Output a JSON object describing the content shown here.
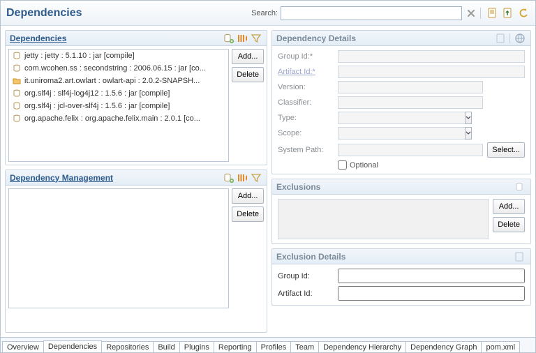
{
  "title": "Dependencies",
  "search": {
    "label": "Search:",
    "value": ""
  },
  "left": {
    "deps": {
      "title": "Dependencies",
      "add": "Add...",
      "delete": "Delete",
      "items": [
        "jetty : jetty : 5.1.10 : jar [compile]",
        "com.wcohen.ss : secondstring : 2006.06.15 : jar [co...",
        "it.uniroma2.art.owlart : owlart-api : 2.0.2-SNAPSH...",
        "org.slf4j : slf4j-log4j12 : 1.5.6 : jar [compile]",
        "org.slf4j : jcl-over-slf4j : 1.5.6 : jar [compile]",
        "org.apache.felix : org.apache.felix.main : 2.0.1 [co..."
      ]
    },
    "mgmt": {
      "title": "Dependency Management",
      "add": "Add...",
      "delete": "Delete"
    }
  },
  "details": {
    "title": "Dependency Details",
    "labels": {
      "group": "Group Id:",
      "artifact": "Artifact Id:",
      "version": "Version:",
      "classifier": "Classifier:",
      "type": "Type:",
      "scope": "Scope:",
      "syspath": "System Path:",
      "optional": "Optional",
      "select": "Select..."
    }
  },
  "exclusions": {
    "title": "Exclusions",
    "add": "Add...",
    "delete": "Delete"
  },
  "excl_details": {
    "title": "Exclusion Details",
    "labels": {
      "group": "Group Id:",
      "artifact": "Artifact Id:"
    }
  },
  "tabs": [
    "Overview",
    "Dependencies",
    "Repositories",
    "Build",
    "Plugins",
    "Reporting",
    "Profiles",
    "Team",
    "Dependency Hierarchy",
    "Dependency Graph",
    "pom.xml"
  ],
  "active_tab": 1
}
